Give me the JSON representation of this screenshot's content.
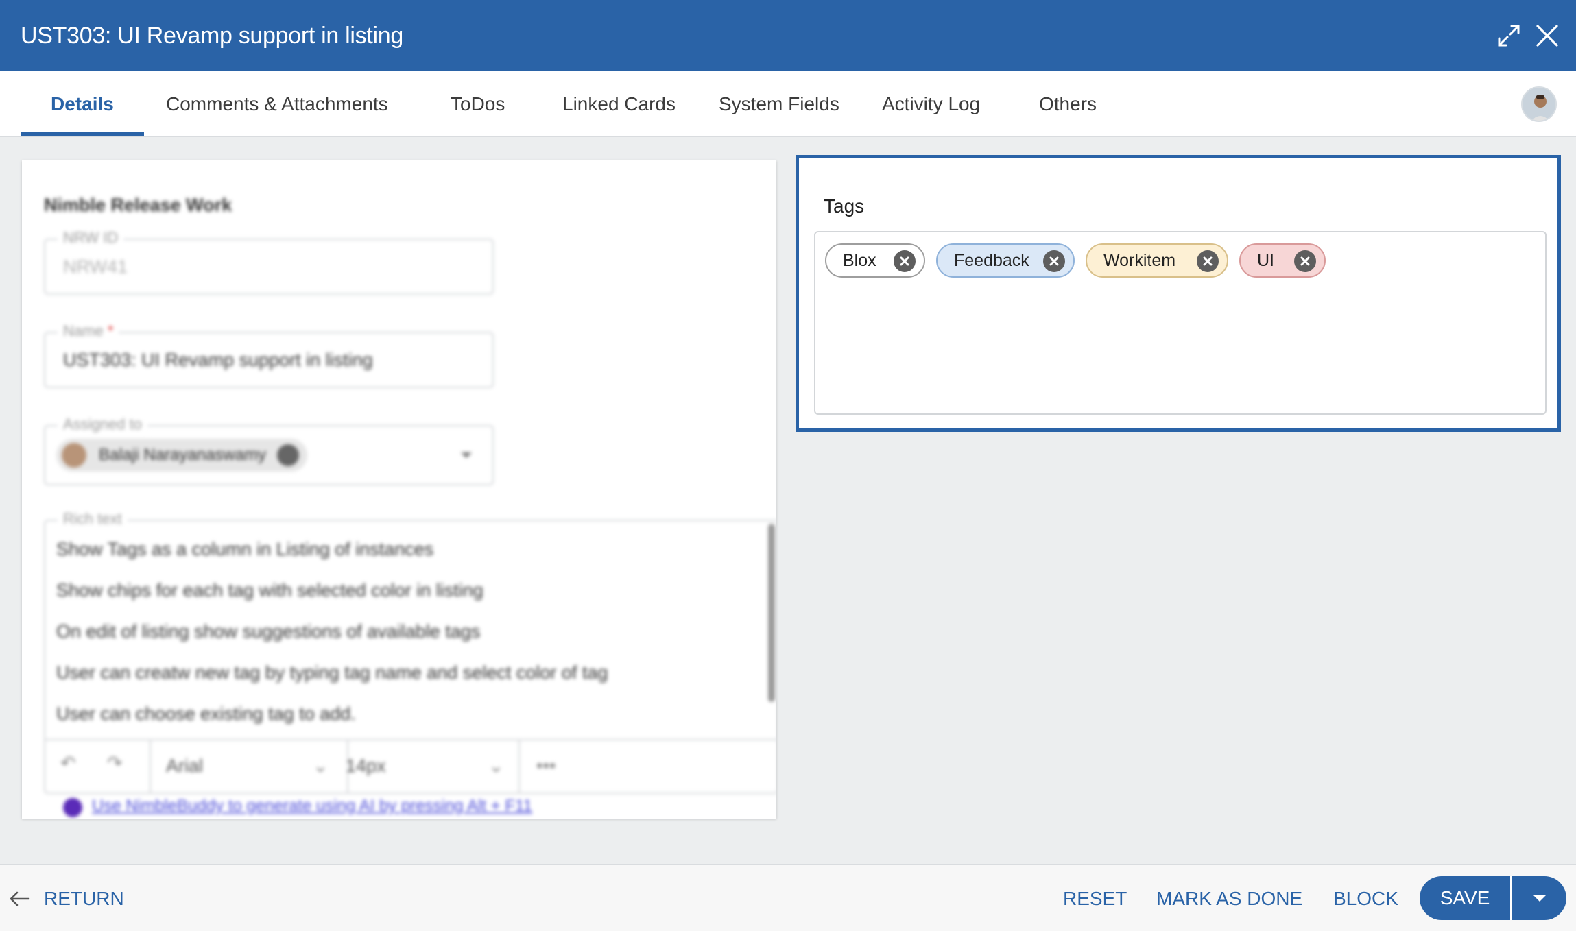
{
  "header": {
    "title": "UST303: UI Revamp support in listing",
    "expand_icon": "expand-icon",
    "close_icon": "close-icon",
    "background": "#2a63a7"
  },
  "tabs": [
    {
      "label": "Details",
      "active": true
    },
    {
      "label": "Comments & Attachments",
      "active": false
    },
    {
      "label": "ToDos",
      "active": false
    },
    {
      "label": "Linked Cards",
      "active": false
    },
    {
      "label": "System Fields",
      "active": false
    },
    {
      "label": "Activity Log",
      "active": false
    },
    {
      "label": "Others",
      "active": false
    }
  ],
  "details": {
    "section_title": "Nimble Release Work",
    "nrw_id": {
      "label": "NRW ID",
      "value": "NRW41"
    },
    "name": {
      "label": "Name",
      "required_mark": "*",
      "value": "UST303: UI Revamp support in listing"
    },
    "assigned_to": {
      "label": "Assigned to",
      "value": "Balaji Narayanaswamy"
    },
    "rich_text": {
      "label": "Rich text",
      "lines": [
        "Show Tags as a column in Listing of instances",
        "Show chips for each tag with selected color in listing",
        "On edit of listing show suggestions of available tags",
        "User can creatw new tag by typing tag name and select color of tag",
        "User can choose existing tag to add."
      ],
      "font": "Arial",
      "size": "14px",
      "more": "•••"
    },
    "ai_hint": "Use NimbleBuddy to generate  using AI  by pressing Alt + F11"
  },
  "tags_panel": {
    "label": "Tags",
    "tags": [
      {
        "label": "Blox",
        "bg": "#ffffff",
        "border": "#9e9e9e"
      },
      {
        "label": "Feedback",
        "bg": "#dbe8f7",
        "border": "#8fb2da"
      },
      {
        "label": "Workitem",
        "bg": "#fdf0d4",
        "border": "#d9c08a"
      },
      {
        "label": "UI",
        "bg": "#f7d6d6",
        "border": "#d99a9a"
      }
    ]
  },
  "footer": {
    "return_label": "RETURN",
    "reset_label": "RESET",
    "mark_done_label": "MARK AS DONE",
    "block_label": "BLOCK",
    "save_label": "SAVE"
  }
}
